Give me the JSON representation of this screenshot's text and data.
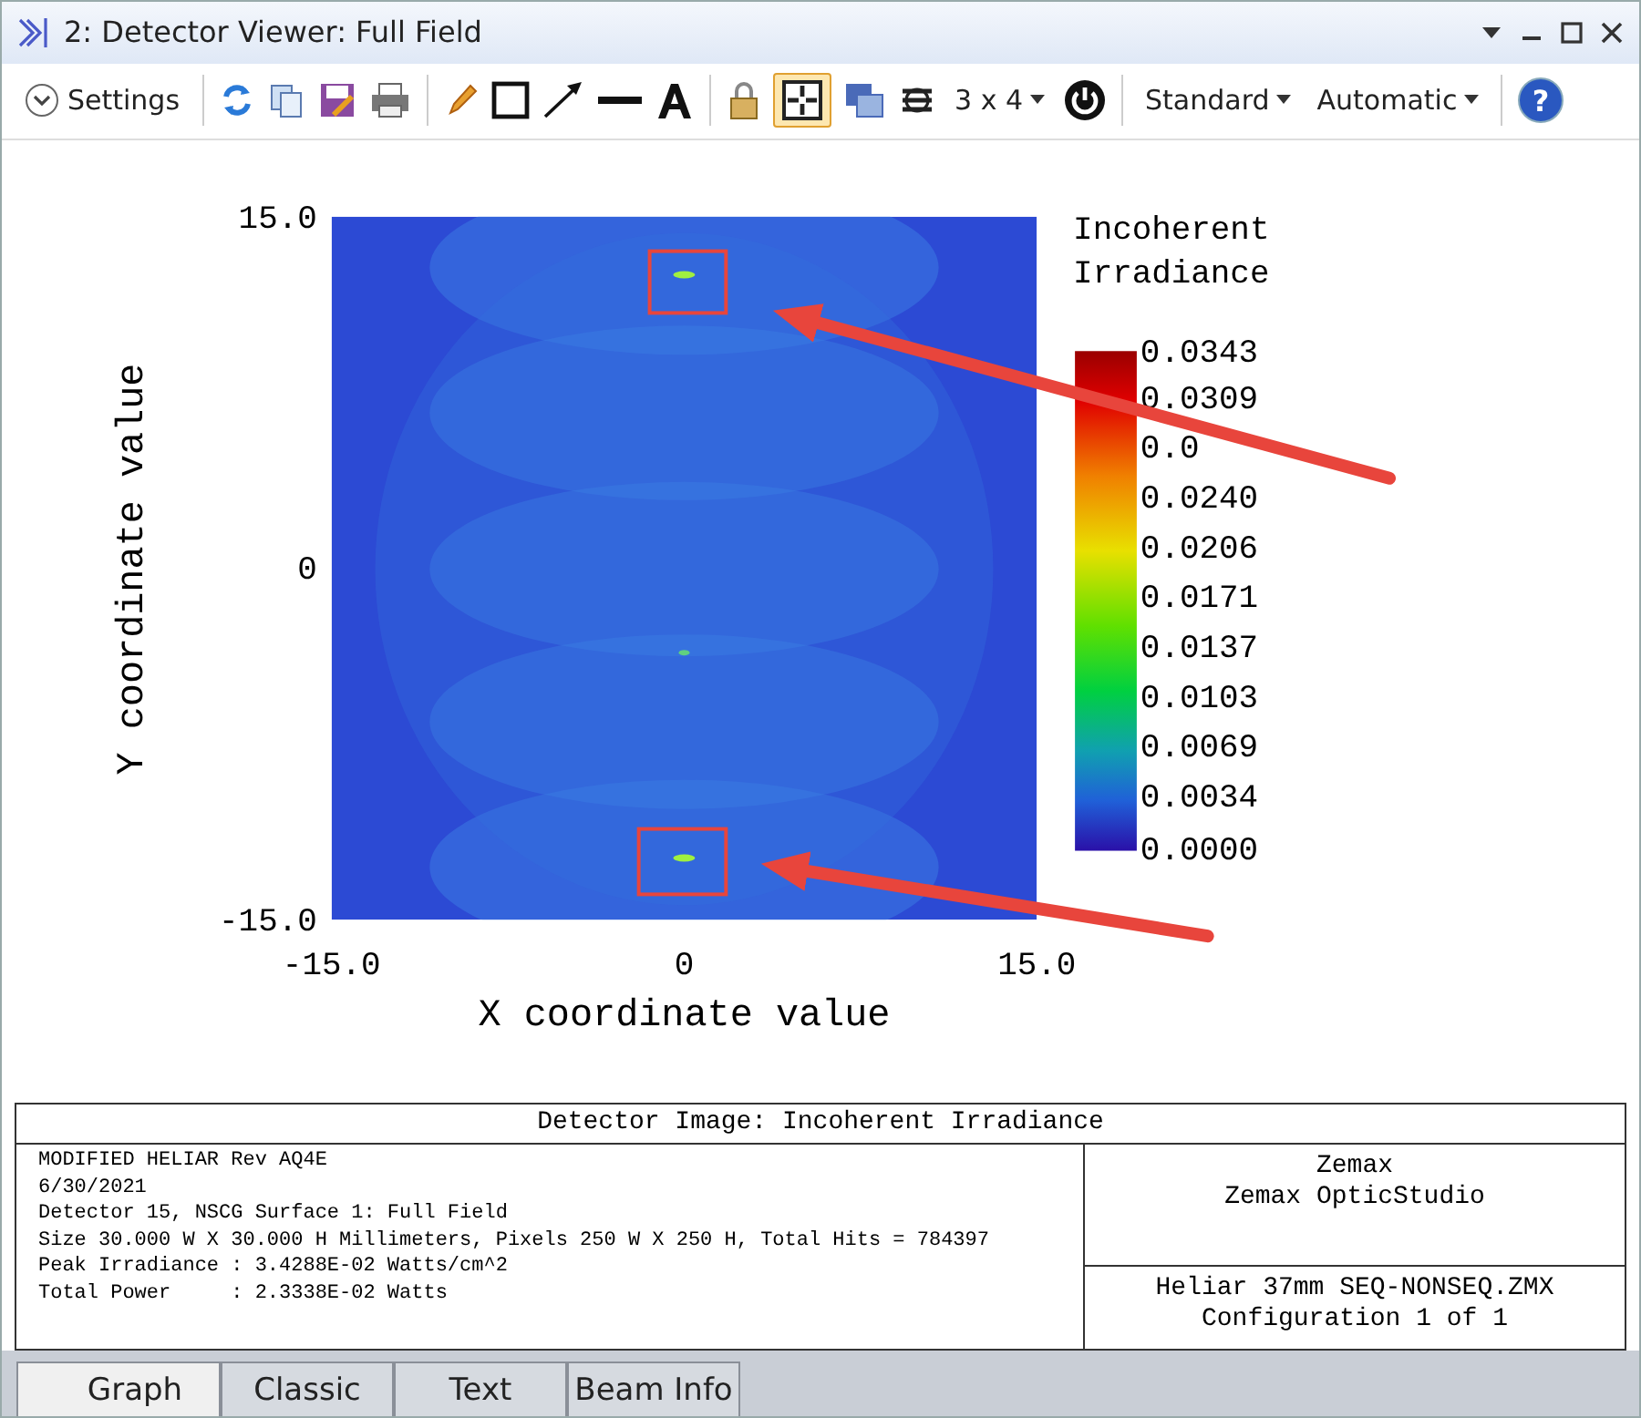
{
  "window": {
    "title": "2: Detector Viewer: Full Field"
  },
  "toolbar": {
    "settings": "Settings",
    "layout": "3 x 4",
    "mode": "Standard",
    "scale": "Automatic",
    "toggle": {
      "on": true
    },
    "help": "?"
  },
  "plot": {
    "y_ticks": [
      "15.0",
      "0",
      "-15.0"
    ],
    "x_ticks": [
      "-15.0",
      "0",
      "15.0"
    ],
    "xlabel": "X coordinate value",
    "ylabel": "Y coordinate value",
    "legend": {
      "title_lines": [
        "Incoherent",
        "Irradiance"
      ],
      "labels": [
        "0.0343",
        "0.0309",
        "0.0",
        "0.0240",
        "0.0206",
        "0.0171",
        "0.0137",
        "0.0103",
        "0.0069",
        "0.0034",
        "0.0000"
      ]
    }
  },
  "info": {
    "title": "Detector Image: Incoherent Irradiance",
    "left_lines": [
      "MODIFIED HELIAR Rev AQ4E",
      "6/30/2021",
      "Detector 15, NSCG Surface 1: Full Field",
      "Size 30.000 W X 30.000 H Millimeters, Pixels 250 W X 250 H, Total Hits = 784397",
      "Peak Irradiance : 3.4288E-02 Watts/cm^2",
      "Total Power     : 2.3338E-02 Watts"
    ],
    "right_top_lines": [
      "Zemax",
      "Zemax OpticStudio"
    ],
    "right_bottom_lines": [
      "Heliar 37mm SEQ-NONSEQ.ZMX",
      "Configuration 1 of 1"
    ]
  },
  "tabs": [
    {
      "label": "Graph",
      "selected": true
    },
    {
      "label": "Classic",
      "selected": false
    },
    {
      "label": "Text",
      "selected": false
    },
    {
      "label": "Beam Info",
      "selected": false
    }
  ]
}
